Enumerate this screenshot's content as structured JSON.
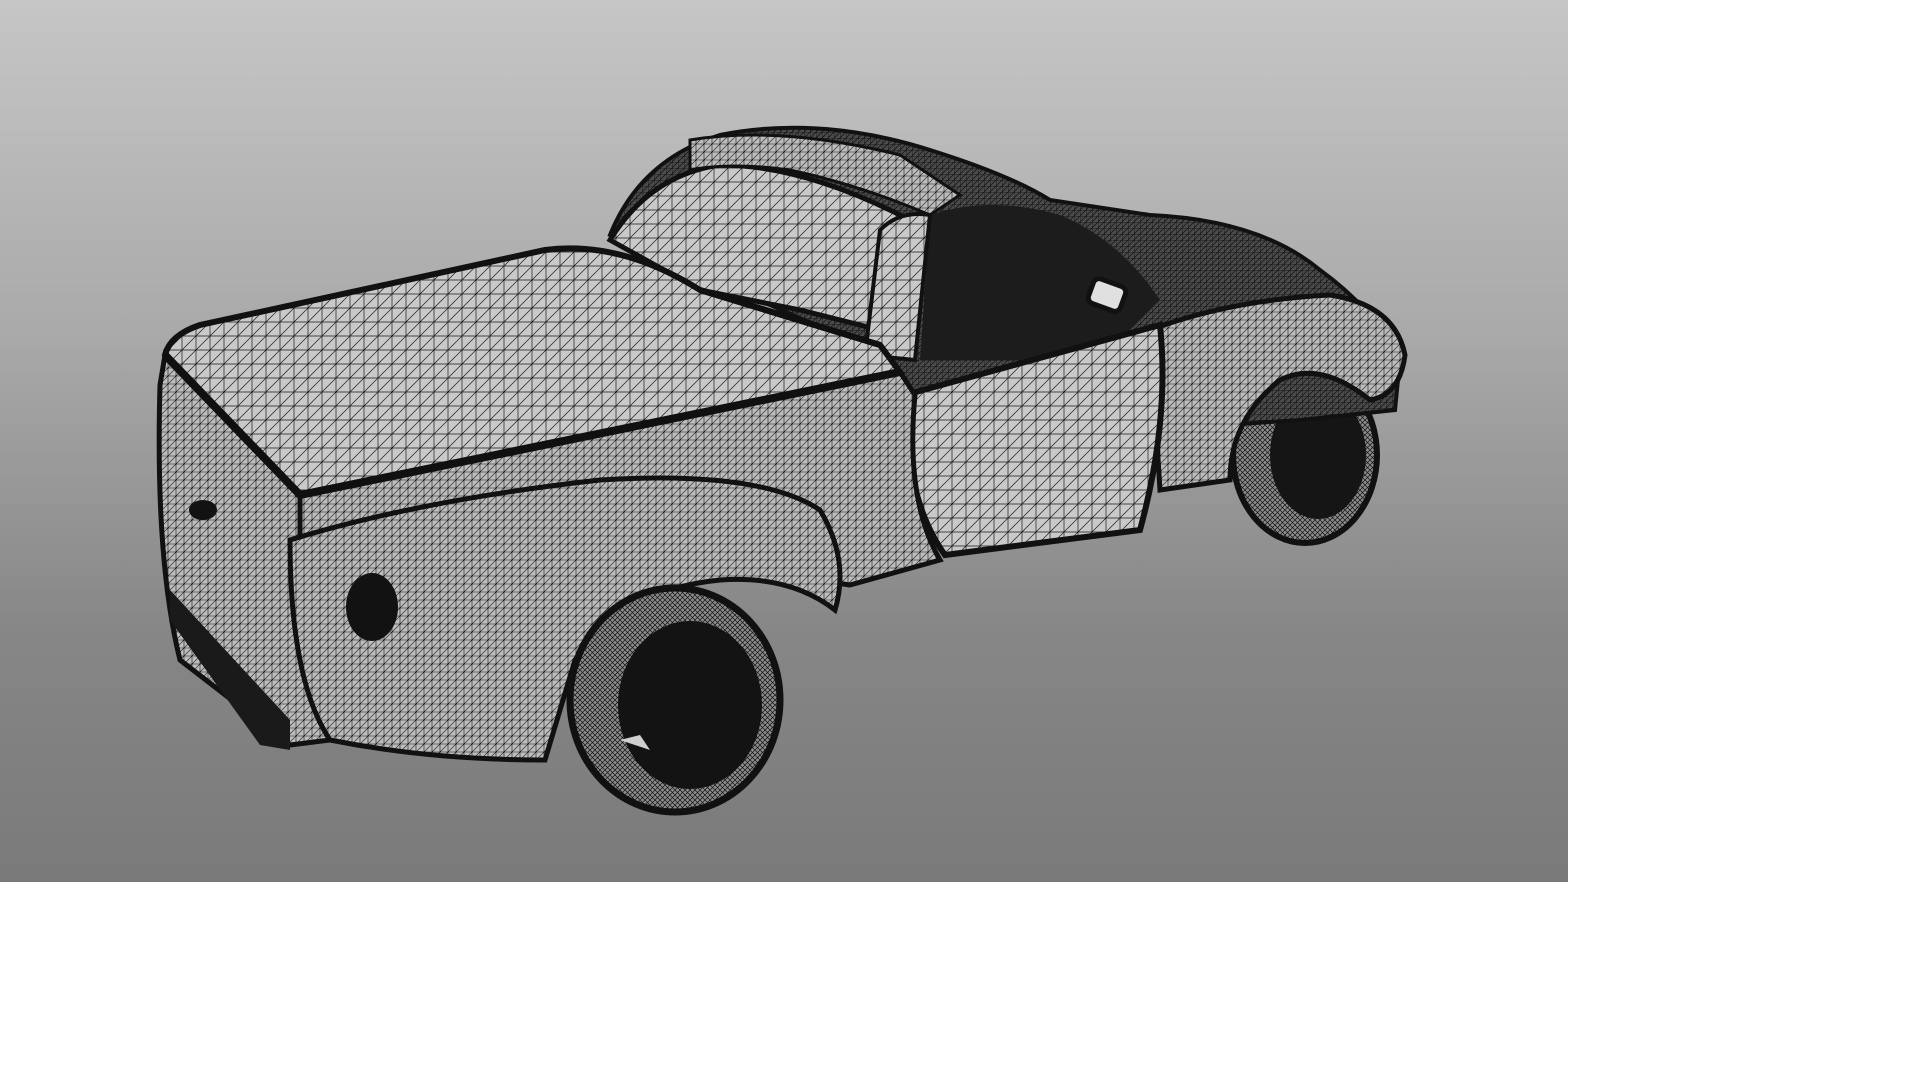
{
  "scene": {
    "subject": "pickup-truck",
    "render_style": "wireframe-mesh",
    "background_gradient": [
      "#c6c6c6",
      "#a9a9a9",
      "#868686",
      "#7a7a7a"
    ],
    "mesh_light": "#d4d4d4",
    "mesh_mid": "#9a9a9a",
    "mesh_dark": "#141414"
  }
}
